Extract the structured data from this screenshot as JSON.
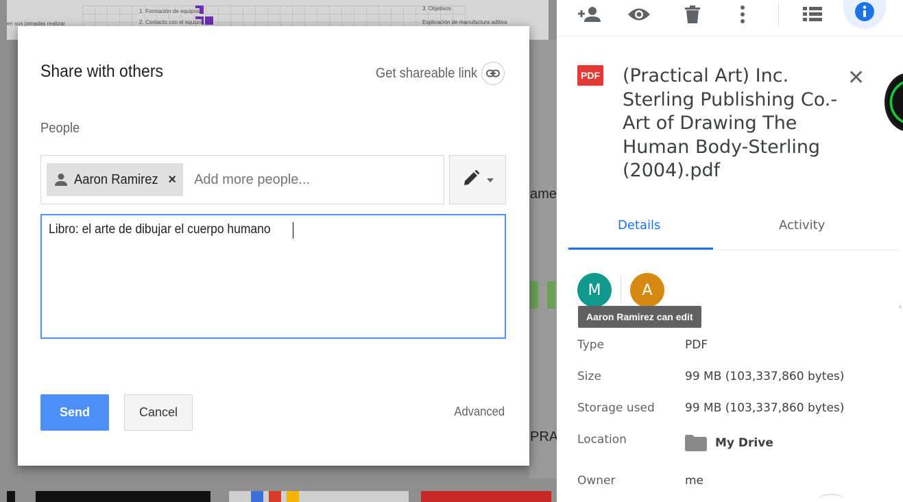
{
  "backdrop": {
    "snippets": [
      "1. Formación de equipos",
      "2. Contacto con el equipo",
      "3. Objetivos",
      "Explicación de manufactura aditiva",
      "en sus jornadas realizar"
    ],
    "right_fragment_1": "ame",
    "right_fragment_2": "PRA"
  },
  "share_dialog": {
    "title": "Share with others",
    "shareable_link_label": "Get shareable link",
    "people_label": "People",
    "chip_name": "Aaron Ramirez",
    "chip_remove": "×",
    "add_people_placeholder": "Add more people...",
    "message": "Libro: el arte de dibujar el cuerpo humano",
    "send_label": "Send",
    "cancel_label": "Cancel",
    "advanced_label": "Advanced"
  },
  "details_panel": {
    "toolbar_icons": [
      "add-person-icon",
      "eye-icon",
      "trash-icon",
      "more-vert-icon",
      "list-view-icon",
      "info-icon"
    ],
    "file_badge": "PDF",
    "file_title": "(Practical Art) Inc. Sterling Publishing Co.-Art of Drawing The Human Body-Sterling (2004).pdf",
    "close_symbol": "✕",
    "tabs": [
      {
        "label": "Details",
        "active": true
      },
      {
        "label": "Activity",
        "active": false
      }
    ],
    "avatars": [
      {
        "initial": "M",
        "color": "#11998e"
      },
      {
        "initial": "A",
        "color": "#d68910"
      }
    ],
    "tooltip": "Aaron Ramirez can edit",
    "properties": [
      {
        "label": "Type",
        "value": "PDF"
      },
      {
        "label": "Size",
        "value": "99 MB (103,337,860 bytes)"
      },
      {
        "label": "Storage used",
        "value": "99 MB (103,337,860 bytes)"
      },
      {
        "label": "Location",
        "value": "My Drive"
      },
      {
        "label": "Owner",
        "value": "me"
      }
    ]
  },
  "colors": {
    "accent_blue": "#1a73e8",
    "send_button": "#4d8ef7",
    "pdf_red": "#e53935"
  }
}
